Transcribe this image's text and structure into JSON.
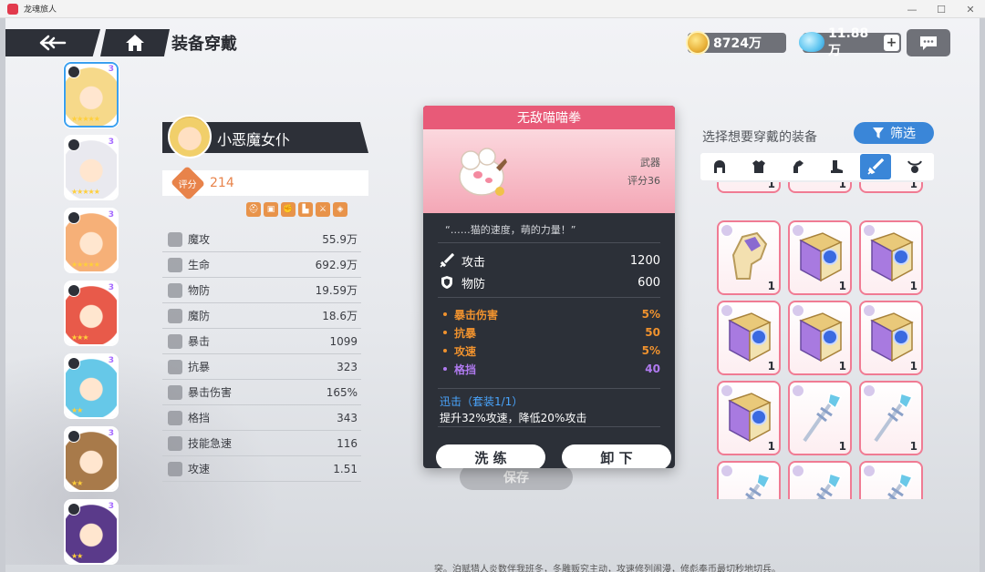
{
  "window": {
    "title": "龙魂旅人",
    "minimize": "—",
    "maximize": "☐",
    "close": "✕"
  },
  "header": {
    "page_title": "装备穿戴",
    "back_icon": "back-arrow-icon",
    "home_icon": "home-icon"
  },
  "currency": {
    "gold": "8724万",
    "gems": "11.88万",
    "add_label": "+"
  },
  "characters": [
    {
      "name": "小恶魔女仆",
      "stars": "★★★★★",
      "selected": true,
      "color": "#f6d98a"
    },
    {
      "stars": "★★★★★",
      "color": "#e9e9ef"
    },
    {
      "stars": "★★★★★",
      "color": "#f6b078"
    },
    {
      "stars": "★★★",
      "color": "#e85a4a"
    },
    {
      "stars": "★★",
      "color": "#66c8e8"
    },
    {
      "stars": "★★",
      "color": "#a87a4a"
    },
    {
      "stars": "★★",
      "color": "#5a3a8a"
    }
  ],
  "char_level_mark": "3",
  "selected_character": {
    "name": "小恶魔女仆",
    "score_label": "评分",
    "score": "214",
    "stats": [
      {
        "name": "魔攻",
        "value": "55.9万"
      },
      {
        "name": "生命",
        "value": "692.9万"
      },
      {
        "name": "物防",
        "value": "19.59万"
      },
      {
        "name": "魔防",
        "value": "18.6万"
      },
      {
        "name": "暴击",
        "value": "1099"
      },
      {
        "name": "抗暴",
        "value": "323"
      },
      {
        "name": "暴击伤害",
        "value": "165%"
      },
      {
        "name": "格挡",
        "value": "343"
      },
      {
        "name": "技能急速",
        "value": "116"
      },
      {
        "name": "攻速",
        "value": "1.51"
      }
    ]
  },
  "save_label": "保存",
  "item_popup": {
    "name": "无敌喵喵拳",
    "type": "武器",
    "score": "评分36",
    "quote": "“……猫的速度，萌的力量！”",
    "main_stats": [
      {
        "name": "攻击",
        "value": "1200",
        "icon": "sword-icon"
      },
      {
        "name": "物防",
        "value": "600",
        "icon": "shield-icon"
      }
    ],
    "sub_stats": [
      {
        "name": "暴击伤害",
        "value": "5%",
        "color": "#f0922e"
      },
      {
        "name": "抗暴",
        "value": "50",
        "color": "#f0922e"
      },
      {
        "name": "攻速",
        "value": "5%",
        "color": "#f0922e"
      },
      {
        "name": "格挡",
        "value": "40",
        "color": "#b07af0"
      }
    ],
    "set_title": "迅击（套装1/1）",
    "set_desc": "提升32%攻速，降低20%攻击",
    "reforge_label": "洗 练",
    "unequip_label": "卸 下"
  },
  "equipment_panel": {
    "title": "选择想要穿戴的装备",
    "filter_label": "筛选",
    "tabs": [
      {
        "icon": "helmet-icon"
      },
      {
        "icon": "armor-icon"
      },
      {
        "icon": "gauntlet-icon"
      },
      {
        "icon": "boots-icon"
      },
      {
        "icon": "weapon-icon",
        "active": true
      },
      {
        "icon": "amulet-icon"
      }
    ],
    "items": [
      {
        "kind": "top",
        "count": "1"
      },
      {
        "kind": "top",
        "count": "1"
      },
      {
        "kind": "top",
        "count": "1"
      },
      {
        "kind": "gauntlet",
        "count": "1"
      },
      {
        "kind": "book",
        "count": "1"
      },
      {
        "kind": "book",
        "count": "1"
      },
      {
        "kind": "book",
        "count": "1"
      },
      {
        "kind": "book",
        "count": "1"
      },
      {
        "kind": "book",
        "count": "1"
      },
      {
        "kind": "book",
        "count": "1"
      },
      {
        "kind": "staff",
        "count": "1"
      },
      {
        "kind": "staff",
        "count": "1"
      },
      {
        "kind": "staff",
        "count": ""
      },
      {
        "kind": "staff",
        "count": ""
      },
      {
        "kind": "staff",
        "count": ""
      }
    ]
  },
  "bottom_text": "突。泊赋猎人炎数伴我班冬，冬雕贩究主动，攻速修列闹漫，修彪奉币最切秒地切兵。"
}
